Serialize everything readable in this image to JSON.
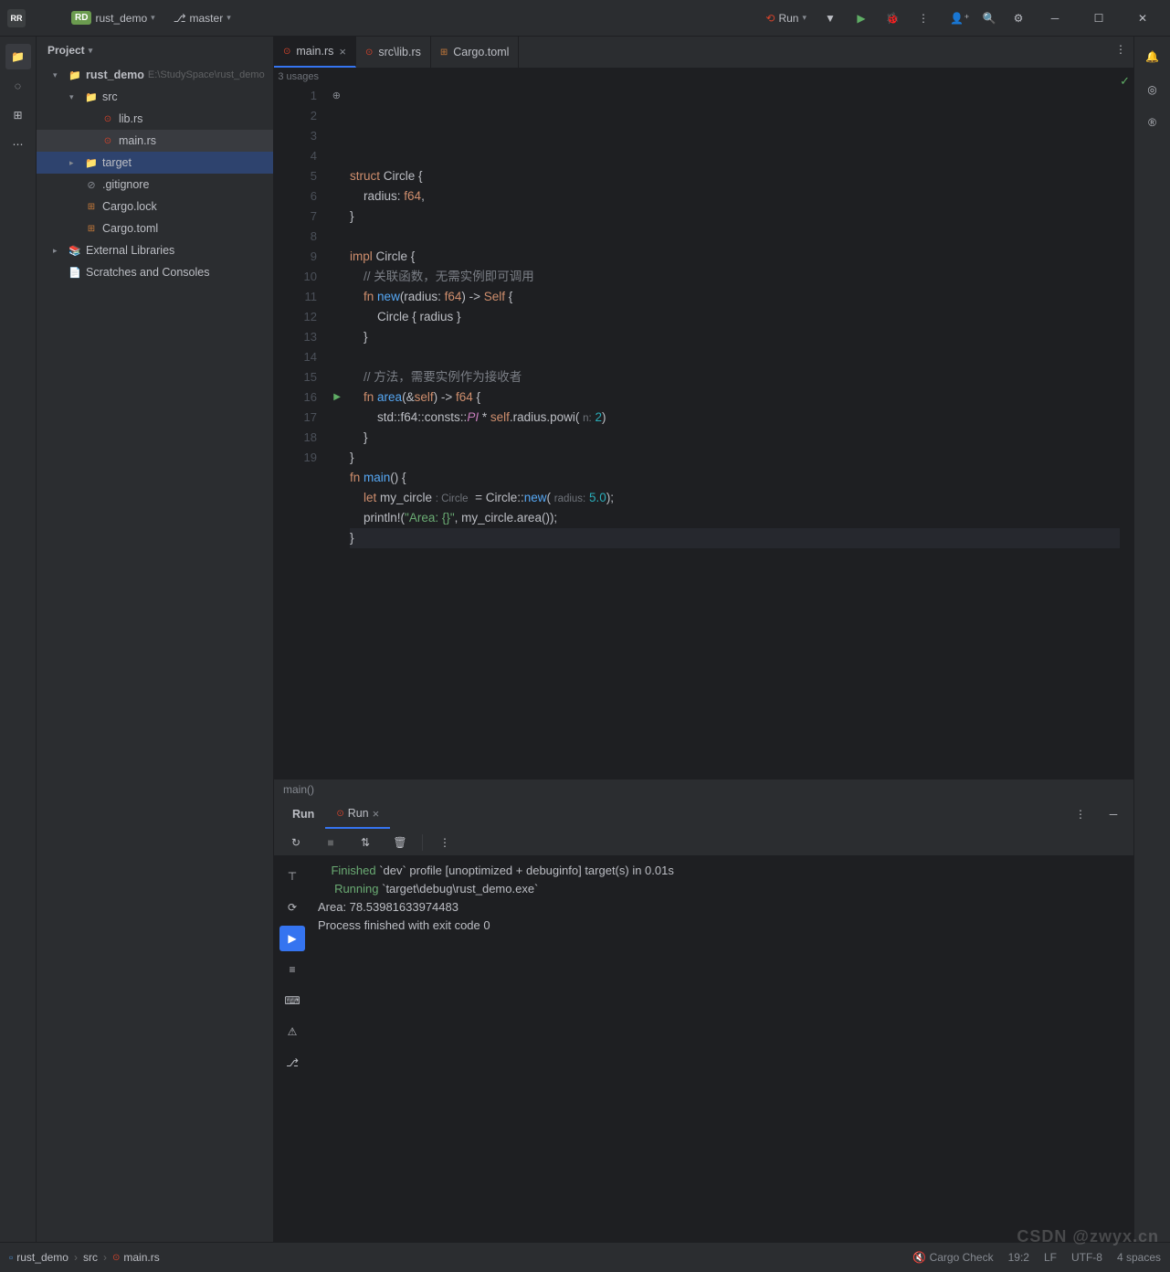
{
  "titlebar": {
    "app_badge": "RR",
    "project_badge": "RD",
    "project_name": "rust_demo",
    "branch_icon": "⎇",
    "branch": "master",
    "run_label": "Run"
  },
  "sidebar": {
    "title": "Project",
    "root": {
      "name": "rust_demo",
      "path": "E:\\StudySpace\\rust_demo"
    },
    "src": {
      "name": "src"
    },
    "files": {
      "lib": "lib.rs",
      "main": "main.rs",
      "target": "target",
      "gitignore": ".gitignore",
      "cargolock": "Cargo.lock",
      "cargotoml": "Cargo.toml"
    },
    "external": "External Libraries",
    "scratches": "Scratches and Consoles"
  },
  "tabs": [
    {
      "icon": "rust",
      "label": "main.rs",
      "active": true,
      "closable": true
    },
    {
      "icon": "rust",
      "label": "src\\lib.rs",
      "active": false,
      "closable": false
    },
    {
      "icon": "toml",
      "label": "Cargo.toml",
      "active": false,
      "closable": false
    }
  ],
  "editor": {
    "usages": "3 usages",
    "lines": [
      {
        "n": 1,
        "hint": "impl",
        "html": "<span class='kw'>struct</span> <span class='ty'>Circle</span> {"
      },
      {
        "n": 2,
        "html": "    radius: <span class='kw'>f64</span>,"
      },
      {
        "n": 3,
        "html": "}"
      },
      {
        "n": 4,
        "html": ""
      },
      {
        "n": 5,
        "html": "<span class='kw'>impl</span> <span class='ty'>Circle</span> {"
      },
      {
        "n": 6,
        "html": "    <span class='cmt'>// 关联函数，无需实例即可调用</span>"
      },
      {
        "n": 7,
        "html": "    <span class='kw'>fn</span> <span class='fn'>new</span>(radius: <span class='kw'>f64</span>) -&gt; <span class='kw'>Self</span> {"
      },
      {
        "n": 8,
        "html": "        Circle { radius }"
      },
      {
        "n": 9,
        "html": "    }"
      },
      {
        "n": 10,
        "html": ""
      },
      {
        "n": 11,
        "html": "    <span class='cmt'>// 方法，需要实例作为接收者</span>"
      },
      {
        "n": 12,
        "html": "    <span class='kw'>fn</span> <span class='fn'>area</span>(&amp;<span class='kw'>self</span>) -&gt; <span class='kw'>f64</span> {"
      },
      {
        "n": 13,
        "html": "        std::f64::consts::<span class='const'>PI</span> * <span class='kw'>self</span>.radius.powi( <span class='hint'>n:</span> <span class='num'>2</span>)"
      },
      {
        "n": 14,
        "html": "    }"
      },
      {
        "n": 15,
        "html": "}"
      },
      {
        "n": 16,
        "run": true,
        "html": "<span class='kw'>fn</span> <span class='fn'>main</span>() {"
      },
      {
        "n": 17,
        "html": "    <span class='kw'>let</span> my_circle <span class='hint'>: Circle</span>  = Circle::<span class='fn'>new</span>( <span class='hint'>radius:</span> <span class='num'>5.0</span>);"
      },
      {
        "n": 18,
        "html": "    <span class='macro'>println!</span>(<span class='str'>\"Area: {}\"</span>, my_circle.area());"
      },
      {
        "n": 19,
        "active": true,
        "html": "}"
      }
    ],
    "breadcrumb": "main()"
  },
  "run_panel": {
    "tab_main": "Run",
    "tab_config": "Run",
    "output_lines": [
      {
        "indent": "    ",
        "green": "Finished",
        "rest": " `dev` profile [unoptimized + debuginfo] target(s) in 0.01s"
      },
      {
        "indent": "     ",
        "green": "Running",
        "rest": " `target\\debug\\rust_demo.exe`"
      },
      {
        "indent": "",
        "green": "",
        "rest": "Area: 78.53981633974483"
      },
      {
        "indent": "",
        "green": "",
        "rest": ""
      },
      {
        "indent": "",
        "green": "",
        "rest": "Process finished with exit code 0"
      }
    ]
  },
  "status_bar": {
    "breadcrumbs": [
      "rust_demo",
      "src",
      "main.rs"
    ],
    "cargo": "Cargo Check",
    "pos": "19:2",
    "line_sep": "LF",
    "encoding": "UTF-8",
    "indent": "4 spaces"
  },
  "watermark": "CSDN @zwyx.cn"
}
